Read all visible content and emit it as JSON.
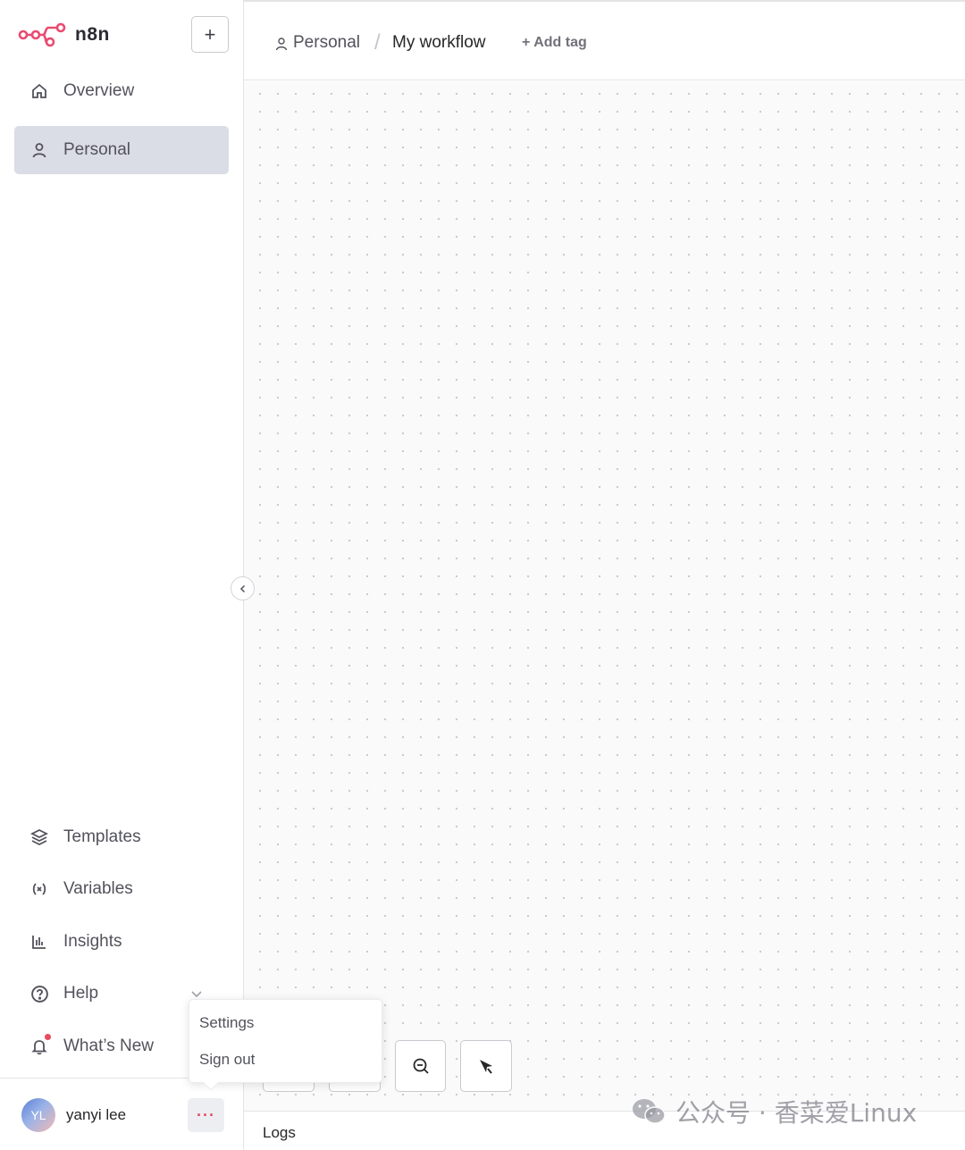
{
  "app": {
    "name": "n8n"
  },
  "sidebar": {
    "new_button": "+",
    "top_items": [
      {
        "label": "Overview",
        "icon": "home-icon"
      },
      {
        "label": "Personal",
        "icon": "user-icon",
        "active": true
      }
    ],
    "bottom_items": [
      {
        "label": "Templates",
        "icon": "box-icon"
      },
      {
        "label": "Variables",
        "icon": "variable-icon"
      },
      {
        "label": "Insights",
        "icon": "bar-chart-icon"
      },
      {
        "label": "Help",
        "icon": "help-circle-icon"
      },
      {
        "label": "What’s New",
        "icon": "bell-icon",
        "has_notification_dot": true
      }
    ],
    "user": {
      "initials": "YL",
      "name": "yanyi lee",
      "more_label": "···"
    }
  },
  "header": {
    "breadcrumb_project": "Personal",
    "breadcrumb_separator": "/",
    "workflow_name": "My workflow",
    "add_tag": "+ Add tag"
  },
  "user_menu": {
    "options": [
      "Settings",
      "Sign out"
    ]
  },
  "canvas": {
    "toolbar": [
      "zoom-out-icon",
      "tidy-up-icon"
    ]
  },
  "logs": {
    "label": "Logs"
  },
  "watermark": {
    "text": "公众号 · 香菜爱Linux"
  },
  "colors": {
    "brand": "#ea4b71",
    "active_bg": "#dadde6",
    "notification": "#e84a5f"
  }
}
